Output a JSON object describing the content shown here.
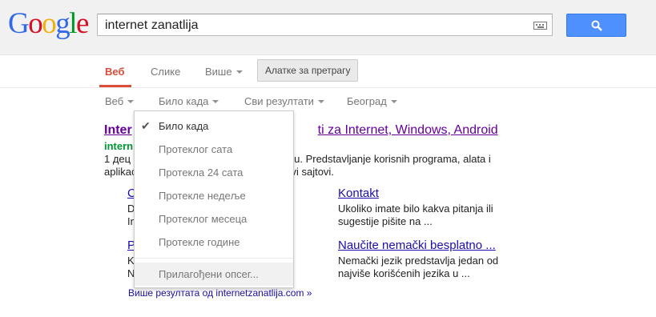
{
  "logo": {
    "letters": [
      "G",
      "o",
      "o",
      "g",
      "l",
      "e"
    ],
    "colors": [
      "#3369e8",
      "#d50f25",
      "#eeb211",
      "#3369e8",
      "#009925",
      "#d50f25"
    ]
  },
  "search": {
    "query": "internet zanatlija"
  },
  "tabs": [
    {
      "label": "Веб",
      "active": true
    },
    {
      "label": "Слике",
      "active": false
    },
    {
      "label": "Више",
      "active": false,
      "has_arrow": true
    }
  ],
  "tools_button": "Алатке за претрагу",
  "filters": [
    "Веб",
    "Било када",
    "Сви резултати",
    "Београд"
  ],
  "result": {
    "title_visible_left": "Inter",
    "title_visible_right": "ti za Internet, Windows, Android",
    "url_visible": "intern",
    "snippet_line1_left": "1 дец",
    "snippet_line1_right": "u. Predstavljanje korisnih programa, alata i",
    "snippet_line2_left": "aplikac",
    "snippet_line2_right": "vi sajtovi."
  },
  "sitelinks": [
    {
      "title_visible": "C",
      "lines": [
        "D",
        "In"
      ]
    },
    {
      "title": "Kontakt",
      "lines": [
        "Ukoliko imate bilo kakva pitanja ili",
        "sugestije pišite na ..."
      ]
    },
    {
      "title_visible": "P",
      "lines": [
        "K",
        "N"
      ]
    },
    {
      "title": "Naučite nemački besplatno ...",
      "lines": [
        "Nemački jezik predstavlja jedan od",
        "najviše korišćenih jezika u ..."
      ]
    }
  ],
  "more_results": "Више резултата од internetzanatlija.com »",
  "time_menu": {
    "items": [
      "Било када",
      "Протеклог сата",
      "Протекла 24 сата",
      "Протекле недеље",
      "Протеклог месеца",
      "Протекле године"
    ],
    "selected_index": 0,
    "custom_range": "Прилагођени опсег..."
  }
}
